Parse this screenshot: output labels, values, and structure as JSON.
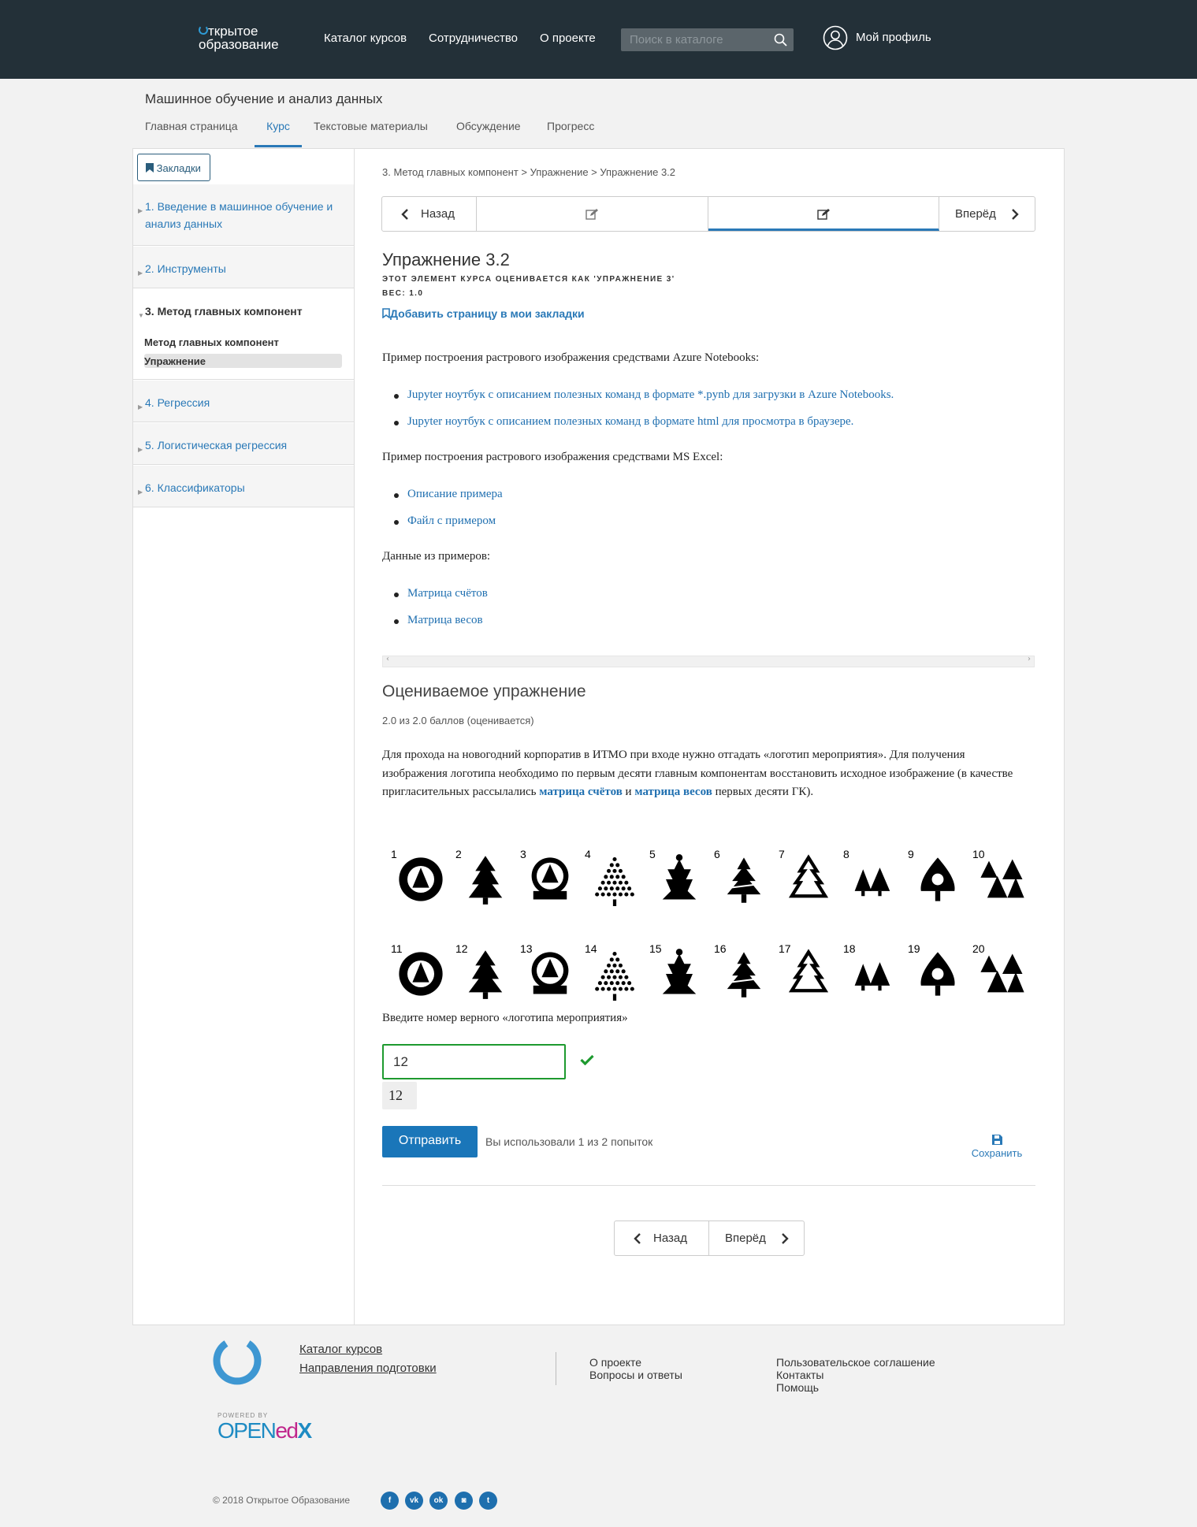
{
  "header": {
    "logo_line1": "ткрытое",
    "logo_line2": "образование",
    "nav": [
      "Каталог курсов",
      "Сотрудничество",
      "О проекте"
    ],
    "search_placeholder": "Поиск в каталоге",
    "profile_label": "Мой профиль"
  },
  "course": {
    "title": "Машинное обучение и анализ данных",
    "tabs": [
      "Главная страница",
      "Курс",
      "Текстовые материалы",
      "Обсуждение",
      "Прогресс"
    ],
    "active_tab": "Курс"
  },
  "sidebar": {
    "bookmarks_label": "Закладки",
    "chapters": [
      {
        "title": "1. Введение в машинное обучение и анализ данных"
      },
      {
        "title": "2. Инструменты"
      },
      {
        "title": "3. Метод главных компонент",
        "open": true,
        "subsections": [
          "Метод главных компонент",
          "Упражнение"
        ],
        "selected_subsection": "Упражнение"
      },
      {
        "title": "4. Регрессия"
      },
      {
        "title": "5. Логистическая регрессия"
      },
      {
        "title": "6. Классификаторы"
      }
    ]
  },
  "content": {
    "breadcrumb": "3. Метод главных компонент > Упражнение > Упражнение 3.2",
    "seq_prev": "Назад",
    "seq_next": "Вперёд",
    "unit_title": "Упражнение 3.2",
    "graded_note": "Этот элемент курса оценивается как 'Упражнение 3'",
    "weight": "Вес: 1.0",
    "add_bookmark": "Добавить страницу в мои закладки",
    "intro_azure": "Пример построения растрового изображения средствами Azure Notebooks:",
    "azure_links": [
      "Jupyter ноутбук с описанием полезных команд в формате *.pynb для загрузки в Azure Notebooks.",
      "Jupyter ноутбук с описанием полезных команд в формате html для просмотра в браузере."
    ],
    "intro_excel": "Пример построения растрового изображения средствами MS Excel:",
    "excel_links": [
      "Описание примера",
      "Файл с примером"
    ],
    "intro_data": "Данные из примеров:",
    "data_links": [
      "Матрица счётов",
      "Матрица весов"
    ]
  },
  "problem": {
    "title": "Оцениваемое упражнение",
    "score": "2.0 из 2.0 баллов (оценивается)",
    "text_before": "Для прохода на новогодний корпоратив в ИТМО при входе нужно отгадать «логотип мероприятия». Для получения изображения логотипа необходимо по первым десяти главным компонентам восстановить исходное изображение (в качестве пригласительных рассылались ",
    "link1": "матрица счётов",
    "text_mid": " и ",
    "link2": "матрица весов",
    "text_after": " первых десяти ГК).",
    "logo_numbers": [
      "1",
      "2",
      "3",
      "4",
      "5",
      "6",
      "7",
      "8",
      "9",
      "10",
      "11",
      "12",
      "13",
      "14",
      "15",
      "16",
      "17",
      "18",
      "19",
      "20"
    ],
    "prompt": "Введите номер верного «логотипа мероприятия»",
    "answer_value": "12",
    "preview_value": "12",
    "submit_label": "Отправить",
    "attempts": "Вы использовали 1 из 2 попыток",
    "save_label": "Сохранить",
    "status": "correct"
  },
  "bottom_nav": {
    "prev": "Назад",
    "next": "Вперёд"
  },
  "footer": {
    "links_main": [
      "Каталог курсов",
      "Направления подготовки"
    ],
    "col2": [
      "О проекте",
      "Вопросы и ответы"
    ],
    "col3": [
      "Пользовательское соглашение",
      "Контакты",
      "Помощь"
    ],
    "powered_by": "POWERED BY",
    "openedx": "OPENedX",
    "copyright": "© 2018 Открытое Образование",
    "social": [
      "facebook-icon",
      "vk-icon",
      "odnoklassniki-icon",
      "instagram-icon",
      "twitter-icon"
    ]
  },
  "colors": {
    "header_bg": "#233038",
    "accent": "#2a79b7",
    "submit": "#1a76b9",
    "correct": "#1e9a2f"
  }
}
